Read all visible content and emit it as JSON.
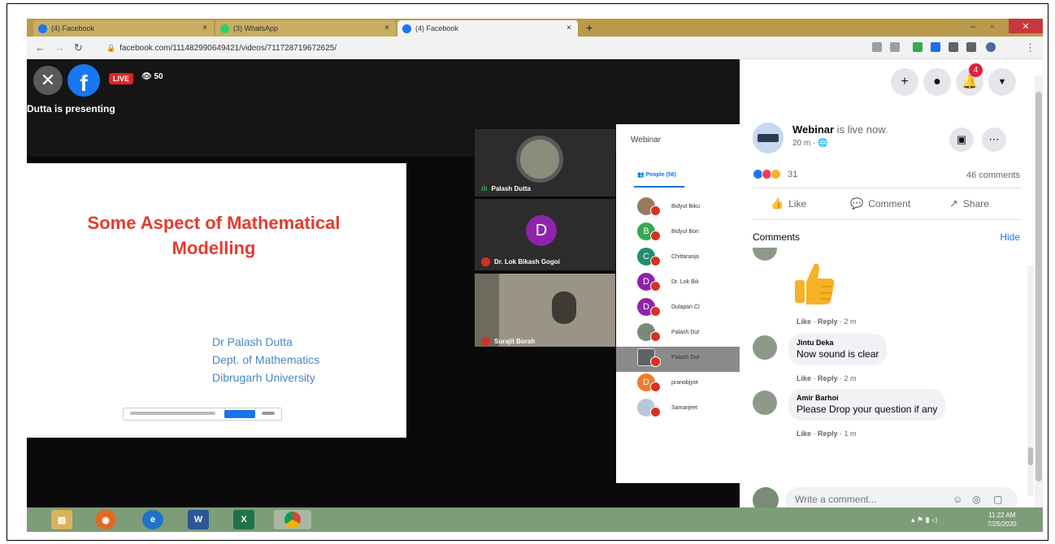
{
  "browser": {
    "tabs": [
      {
        "title": "(4) Facebook",
        "color": "#1877f2"
      },
      {
        "title": "(3) WhatsApp",
        "color": "#25d366"
      },
      {
        "title": "(4) Facebook",
        "color": "#1877f2"
      }
    ],
    "tab_close": "×",
    "new_tab": "+",
    "url": "facebook.com/111482990649421/videos/711728719672625/",
    "window_min": "–",
    "window_max": "▫",
    "window_close": "✕"
  },
  "video": {
    "live_label": "LIVE",
    "viewers": "50",
    "presenting_text": "Dutta is presenting"
  },
  "slide": {
    "title_line1": "Some Aspect of Mathematical",
    "title_line2": "Modelling",
    "author": "Dr Palash Dutta",
    "dept": "Dept. of Mathematics",
    "university": "Dibrugarh University"
  },
  "meet": {
    "tiles": [
      {
        "name": "Palash Dutta"
      },
      {
        "name": "Dr. Lok Bikash Gogoi",
        "initial": "D"
      },
      {
        "name": "Surajit Borah"
      }
    ],
    "panel_title": "Webinar",
    "people_tab": "People (56)",
    "people": [
      {
        "name": "Bidyut Biku",
        "initial": "",
        "color": "#9a7a5a"
      },
      {
        "name": "Bidyut Bon",
        "initial": "B",
        "color": "#34a853"
      },
      {
        "name": "Chittaranja",
        "initial": "C",
        "color": "#1e8e6e"
      },
      {
        "name": "Dr. Lok Bik",
        "initial": "D",
        "color": "#8e24aa"
      },
      {
        "name": "Dulapan Cl",
        "initial": "D",
        "color": "#8e24aa"
      },
      {
        "name": "Palash Dut",
        "initial": "",
        "color": "#7a8a7a"
      },
      {
        "name": "Palash Dut",
        "initial": "",
        "color": "#5f6368"
      },
      {
        "name": "pranobjyot",
        "initial": "D",
        "color": "#f07b2c"
      },
      {
        "name": "Samarjeet",
        "initial": "",
        "color": "#b8c8d8"
      }
    ]
  },
  "facebook": {
    "notif_count": "4",
    "post": {
      "page_name": "Webinar",
      "status": " is live now.",
      "meta": "20 m · 🌐",
      "reaction_count": "31",
      "comment_count": "46 comments"
    },
    "actions": {
      "like": "Like",
      "comment": "Comment",
      "share": "Share"
    },
    "comments_heading": "Comments",
    "hide": "Hide",
    "comments": [
      {
        "name": "Jintu Deka",
        "text": "Now sound is clear",
        "like": "Like",
        "reply": "Reply",
        "time": "2 m"
      },
      {
        "name": "Amir Barhoi",
        "text": "Please Drop your question if any",
        "like": "Like",
        "reply": "Reply",
        "time": "1 m"
      }
    ],
    "sticker_meta": {
      "like": "Like",
      "reply": "Reply",
      "time": "2 m"
    },
    "composer_placeholder": "Write a comment..."
  },
  "taskbar": {
    "time": "11:22 AM",
    "date": "7/25/2020"
  }
}
